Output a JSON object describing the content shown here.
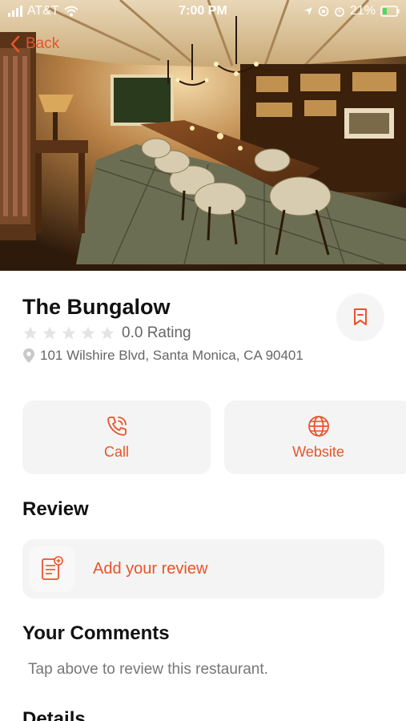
{
  "status_bar": {
    "carrier": "AT&T",
    "time": "7:00 PM",
    "battery": "21%"
  },
  "nav": {
    "back_label": "Back"
  },
  "restaurant": {
    "name": "The Bungalow",
    "rating_value": 0,
    "rating_text": "0.0 Rating",
    "address": "101 Wilshire Blvd, Santa Monica, CA 90401"
  },
  "actions": {
    "call_label": "Call",
    "website_label": "Website"
  },
  "review": {
    "heading": "Review",
    "add_label": "Add your review"
  },
  "comments": {
    "heading": "Your Comments",
    "hint": "Tap above to review this restaurant."
  },
  "details": {
    "heading": "Details"
  },
  "colors": {
    "accent": "#e8542a",
    "card_bg": "#f4f4f4"
  },
  "icons": [
    "back-chevron-icon",
    "star-icon",
    "location-pin-icon",
    "bookmark-icon",
    "phone-icon",
    "globe-icon",
    "review-document-icon"
  ]
}
